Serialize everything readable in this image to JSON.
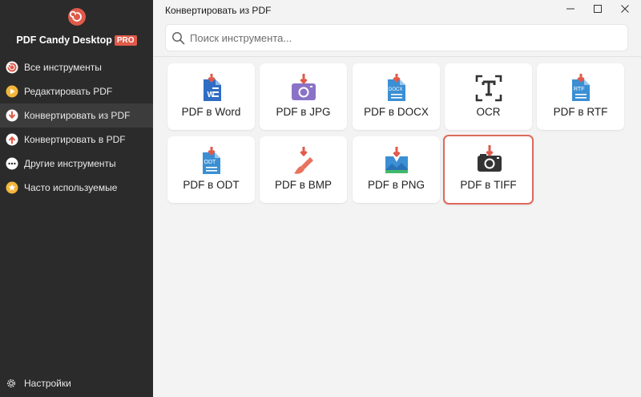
{
  "app": {
    "name": "PDF Candy Desktop",
    "badge": "PRO",
    "window_title": "Конвертировать из PDF"
  },
  "colors": {
    "accent": "#e05a4a",
    "sidebar_bg": "#2b2b2b",
    "sidebar_active": "#3c3c3c",
    "selected_border": "#dd6a5a"
  },
  "sidebar": {
    "items": [
      {
        "label": "Все инструменты",
        "icon": "candy-icon"
      },
      {
        "label": "Редактировать PDF",
        "icon": "play-icon"
      },
      {
        "label": "Конвертировать из PDF",
        "icon": "arrow-down-icon",
        "active": true
      },
      {
        "label": "Конвертировать в PDF",
        "icon": "arrow-up-icon"
      },
      {
        "label": "Другие инструменты",
        "icon": "dots-icon"
      },
      {
        "label": "Часто используемые",
        "icon": "star-icon"
      }
    ],
    "settings": {
      "label": "Настройки",
      "icon": "gear-icon"
    }
  },
  "search": {
    "placeholder": "Поиск инструмента..."
  },
  "tools": [
    {
      "label": "PDF в Word",
      "icon": "word-doc-icon"
    },
    {
      "label": "PDF в JPG",
      "icon": "jpg-image-icon"
    },
    {
      "label": "PDF в DOCX",
      "icon": "docx-doc-icon"
    },
    {
      "label": "OCR",
      "icon": "ocr-text-icon"
    },
    {
      "label": "PDF в RTF",
      "icon": "rtf-doc-icon"
    },
    {
      "label": "PDF в ODT",
      "icon": "odt-doc-icon"
    },
    {
      "label": "PDF в BMP",
      "icon": "paintbrush-icon"
    },
    {
      "label": "PDF в PNG",
      "icon": "png-image-icon"
    },
    {
      "label": "PDF в TIFF",
      "icon": "camera-icon",
      "selected": true
    }
  ]
}
